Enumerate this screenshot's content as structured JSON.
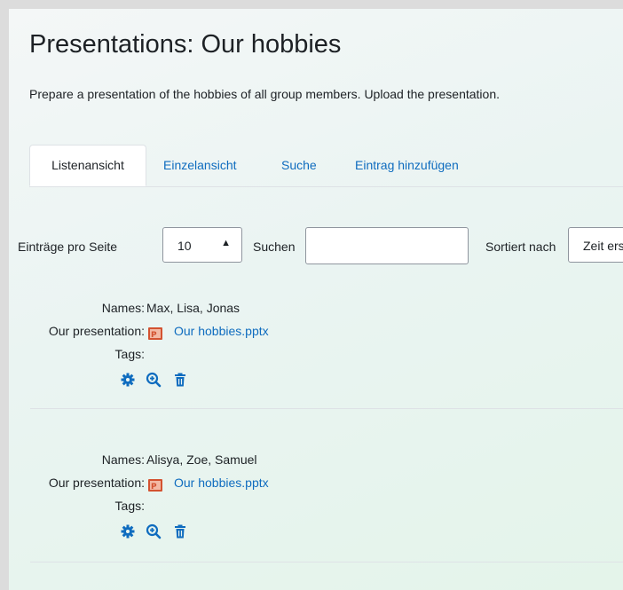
{
  "page": {
    "title": "Presentations: Our hobbies",
    "description": "Prepare a presentation of the hobbies of all group members. Upload the presentation."
  },
  "tabs": [
    {
      "label": "Listenansicht",
      "active": true
    },
    {
      "label": "Einzelansicht",
      "active": false
    },
    {
      "label": "Suche",
      "active": false
    },
    {
      "label": "Eintrag hinzufügen",
      "active": false
    }
  ],
  "controls": {
    "per_page_label": "Einträge pro Seite",
    "per_page_value": "10",
    "search_label": "Suchen",
    "search_value": "",
    "sort_label": "Sortiert nach",
    "sort_value": "Zeit erstellt"
  },
  "field_labels": {
    "names": "Names:",
    "presentation": "Our presentation:",
    "tags": "Tags:"
  },
  "entries": [
    {
      "names": "Max, Lisa, Jonas",
      "file": "Our hobbies.pptx",
      "tags": ""
    },
    {
      "names": "Alisya, Zoe, Samuel",
      "file": "Our hobbies.pptx",
      "tags": ""
    }
  ],
  "colors": {
    "link": "#0f6cbf",
    "text": "#1d2125",
    "ppt_icon": "#d35230"
  },
  "icons": [
    "cog-icon",
    "zoom-in-icon",
    "trash-icon",
    "powerpoint-file-icon",
    "select-arrows-icon"
  ]
}
